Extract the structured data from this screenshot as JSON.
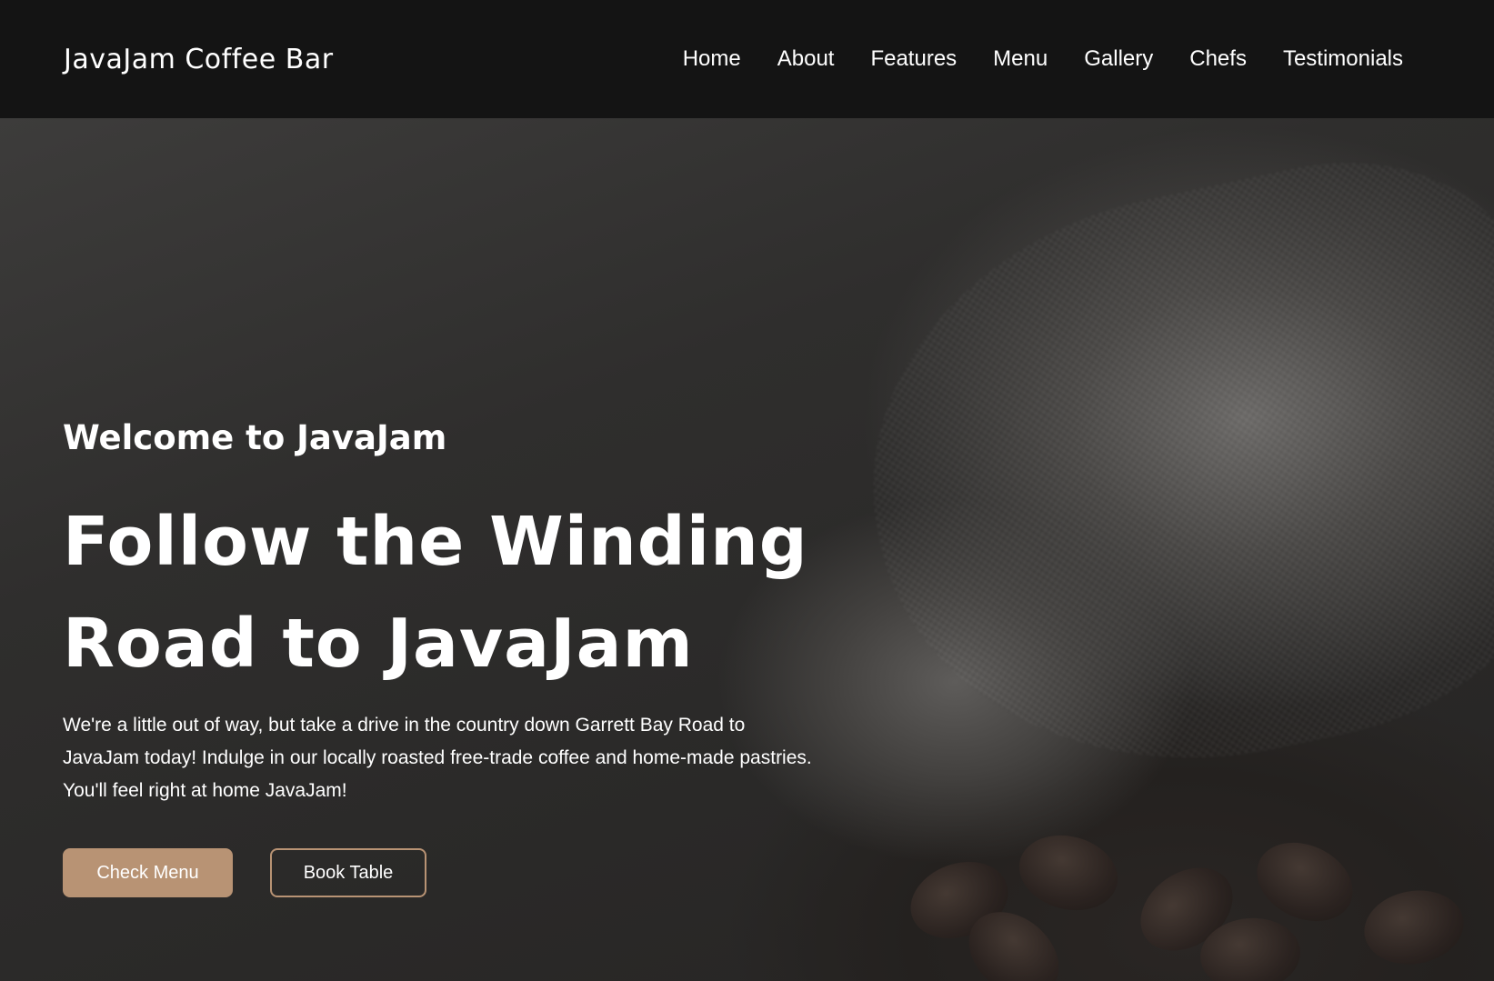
{
  "navbar": {
    "brand": "JavaJam Coffee Bar",
    "links": [
      "Home",
      "About",
      "Features",
      "Menu",
      "Gallery",
      "Chefs",
      "Testimonials"
    ]
  },
  "hero": {
    "welcome": "Welcome to JavaJam",
    "headline": "Follow the Winding Road to JavaJam",
    "intro": "We're a little out of way, but take a drive in the country down Garrett Bay Road to JavaJam today! Indulge in our locally roasted free-trade coffee and home-made pastries. You'll feel right at home JavaJam!",
    "primary_button": "Check Menu",
    "secondary_button": "Book Table"
  },
  "colors": {
    "navbar_bg": "#141414",
    "accent": "#b89374",
    "text": "#ffffff"
  }
}
